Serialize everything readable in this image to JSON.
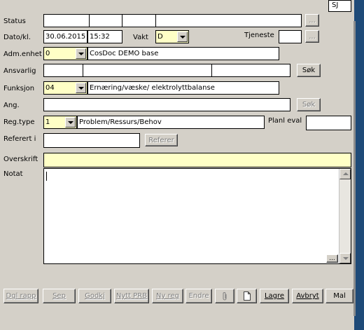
{
  "user_badge": "SJ",
  "labels": {
    "status": "Status",
    "dato": "Dato/kl.",
    "vakt": "Vakt",
    "tjeneste": "Tjeneste",
    "adm": "Adm.enhet",
    "ansvarlig": "Ansvarlig",
    "funksjon": "Funksjon",
    "ang": "Ang.",
    "regtype": "Reg.type",
    "planl": "Planl eval",
    "referert": "Referert i",
    "overskrift": "Overskrift",
    "notat": "Notat"
  },
  "fields": {
    "date": "30.06.2015",
    "time": "15:32",
    "vakt": "D",
    "adm_code": "0",
    "adm_name": "CosDoc DEMO base",
    "funksjon_code": "04",
    "funksjon_name": "Ernæring/væske/ elektrolyttbalanse",
    "regtype_code": "1",
    "regtype_name": "Problem/Ressurs/Behov"
  },
  "buttons": {
    "ellipsis": "...",
    "sok": "Søk",
    "referer": "Referer",
    "dgl_rapp": "Dgl rapp",
    "sep": "Sep",
    "godkj": "Godkj",
    "nytt_prb": "Nytt PRB",
    "ny_reg": "Ny reg",
    "endre": "Endre",
    "lagre": "Lagre",
    "avbryt": "Avbryt",
    "mal": "Mal"
  },
  "icons": {
    "attach": "paperclip-icon",
    "doc": "document-icon"
  }
}
